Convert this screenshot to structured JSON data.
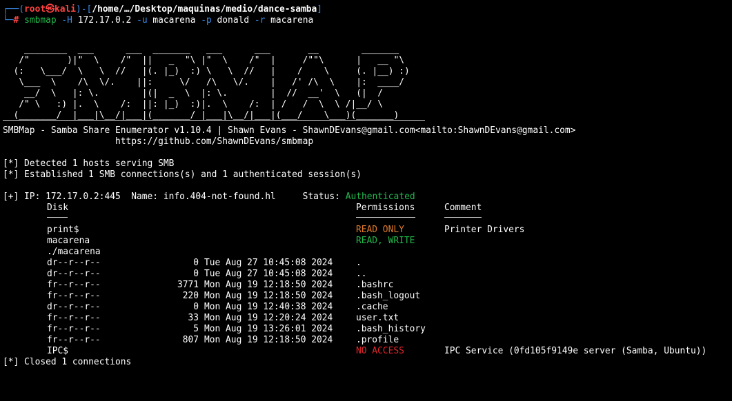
{
  "prompt": {
    "bracket_open": "┌──(",
    "user": "root",
    "at": "㉿",
    "host": "kali",
    "path_sep": ")-[",
    "path": "/home/…/Desktop/maquinas/medio/dance-samba",
    "path_close": "]",
    "line2_prefix": "└─",
    "hash": "#",
    "cmd_name": "smbmap",
    "cmd_args": [
      {
        "flag": "-H",
        "value": "172.17.0.2"
      },
      {
        "flag": "-u",
        "value": "macarena"
      },
      {
        "flag": "-p",
        "value": "donald"
      },
      {
        "flag": "-r",
        "value": "macarena"
      }
    ]
  },
  "ascii_art": [
    "    ________  ___      ___  _______   ___      ___       __        _______",
    "   /\"       )|\"  \\    /\"  ||   _  \"\\ |\"  \\    /\"  |     /\"\"\\      |   __ \"\\",
    "  (:   \\___/  \\   \\  //   |(. |_)  :) \\   \\  //   |    /    \\     (. |__) :)",
    "   \\___  \\    /\\  \\/.    ||:     \\/   /\\   \\/.    |   /' /\\  \\    |:  ____/",
    "    __/  \\   |: \\.        |(|  _  \\  |: \\.        |  //  __'  \\   (|  /",
    "   /\" \\   :) |.  \\    /:  ||: |_)  :)|.  \\    /:  | /   /  \\  \\ /|__/ \\",
    "  (_______/  |___|\\__/|___|(_______/ |___|\\__/|___|(___/    \\___)(_______)"
  ],
  "banner": {
    "line1": "SMBMap - Samba Share Enumerator v1.10.4 | Shawn Evans - ShawnDEvans@gmail.com<mailto:ShawnDEvans@gmail.com>",
    "line2": "                     https://github.com/ShawnDEvans/smbmap"
  },
  "messages": {
    "detected": "[*] Detected 1 hosts serving SMB",
    "established": "[*] Established 1 SMB connections(s) and 1 authenticated session(s)"
  },
  "host": {
    "prefix": "[+] IP: 172.17.0.2:445  Name: info.404-not-found.hl     Status: ",
    "status": "Authenticated"
  },
  "headers": {
    "disk": "Disk",
    "permissions": "Permissions",
    "comment": "Comment"
  },
  "shares": [
    {
      "name": "print$",
      "permission": "READ ONLY",
      "perm_color": "orange",
      "comment": "Printer Drivers"
    },
    {
      "name": "macarena",
      "permission": "READ, WRITE",
      "perm_color": "green",
      "comment": ""
    }
  ],
  "listing_path": "./macarena",
  "files": [
    {
      "perms": "dr--r--r--",
      "size": "0",
      "date": "Tue Aug 27 10:45:08 2024",
      "name": "."
    },
    {
      "perms": "dr--r--r--",
      "size": "0",
      "date": "Tue Aug 27 10:45:08 2024",
      "name": ".."
    },
    {
      "perms": "fr--r--r--",
      "size": "3771",
      "date": "Mon Aug 19 12:18:50 2024",
      "name": ".bashrc"
    },
    {
      "perms": "fr--r--r--",
      "size": "220",
      "date": "Mon Aug 19 12:18:50 2024",
      "name": ".bash_logout"
    },
    {
      "perms": "dr--r--r--",
      "size": "0",
      "date": "Mon Aug 19 12:40:38 2024",
      "name": ".cache"
    },
    {
      "perms": "fr--r--r--",
      "size": "33",
      "date": "Mon Aug 19 12:20:24 2024",
      "name": "user.txt"
    },
    {
      "perms": "fr--r--r--",
      "size": "5",
      "date": "Mon Aug 19 13:26:01 2024",
      "name": ".bash_history"
    },
    {
      "perms": "fr--r--r--",
      "size": "807",
      "date": "Mon Aug 19 12:18:50 2024",
      "name": ".profile"
    }
  ],
  "ipc": {
    "name": "IPC$",
    "permission": "NO ACCESS",
    "comment": "IPC Service (0fd105f9149e server (Samba, Ubuntu))"
  },
  "closed": "[*] Closed 1 connections",
  "colors": {
    "prompt_blue": "#3b8eea",
    "root_red": "#ff4343",
    "authenticated_green": "#22b84c",
    "read_only_orange": "#e07b2a",
    "no_access_red": "#e5262b",
    "background": "#000000"
  }
}
